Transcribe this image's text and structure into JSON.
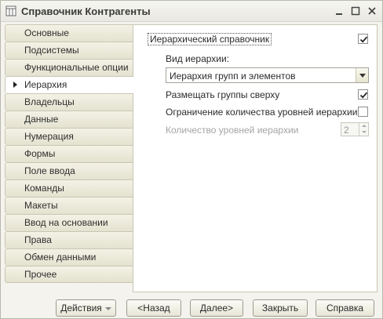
{
  "window": {
    "title": "Справочник Контрагенты",
    "icon": "table-icon"
  },
  "tabs": [
    {
      "label": "Основные",
      "active": false
    },
    {
      "label": "Подсистемы",
      "active": false
    },
    {
      "label": "Функциональные опции",
      "active": false
    },
    {
      "label": "Иерархия",
      "active": true
    },
    {
      "label": "Владельцы",
      "active": false
    },
    {
      "label": "Данные",
      "active": false
    },
    {
      "label": "Нумерация",
      "active": false
    },
    {
      "label": "Формы",
      "active": false
    },
    {
      "label": "Поле ввода",
      "active": false
    },
    {
      "label": "Команды",
      "active": false
    },
    {
      "label": "Макеты",
      "active": false
    },
    {
      "label": "Ввод на основании",
      "active": false
    },
    {
      "label": "Права",
      "active": false
    },
    {
      "label": "Обмен данными",
      "active": false
    },
    {
      "label": "Прочее",
      "active": false
    }
  ],
  "panel": {
    "hierarchical_label": "Иерархический справочник",
    "hierarchical_checked": true,
    "hierarchy_type_label": "Вид иерархии:",
    "hierarchy_type_value": "Иерархия групп и элементов",
    "groups_on_top_label": "Размещать группы сверху",
    "groups_on_top_checked": true,
    "limit_levels_label": "Ограничение количества уровней иерархии",
    "limit_levels_checked": false,
    "levels_count_label": "Количество уровней иерархии",
    "levels_count_value": "2"
  },
  "buttons": {
    "actions": "Действия",
    "back": "<Назад",
    "next": "Далее>",
    "close": "Закрыть",
    "help": "Справка"
  }
}
